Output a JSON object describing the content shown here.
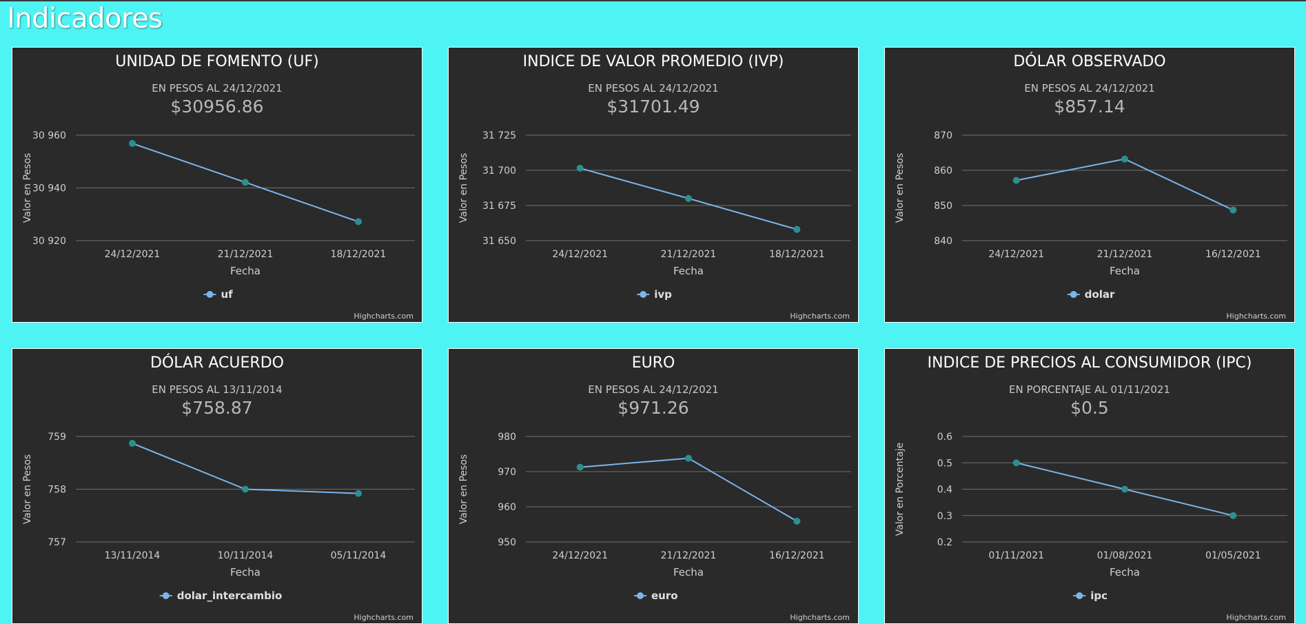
{
  "page": {
    "title": "Indicadores"
  },
  "chart_data": [
    {
      "type": "line",
      "title": "UNIDAD DE FOMENTO (UF)",
      "subtitle": "EN PESOS AL 24/12/2021",
      "value_text": "$30956.86",
      "categories": [
        "24/12/2021",
        "21/12/2021",
        "18/12/2021"
      ],
      "series": [
        {
          "name": "uf",
          "values": [
            30956.86,
            30942.1,
            30927.2
          ]
        }
      ],
      "xlabel": "Fecha",
      "ylabel": "Valor en Pesos",
      "ylim": [
        30920,
        30960
      ],
      "yticks": [
        30920,
        30940,
        30960
      ],
      "ytick_labels": [
        "30 920",
        "30 940",
        "30 960"
      ],
      "grid": true,
      "legend": "bottom-center",
      "credits": "Highcharts.com"
    },
    {
      "type": "line",
      "title": "INDICE DE VALOR PROMEDIO (IVP)",
      "subtitle": "EN PESOS AL 24/12/2021",
      "value_text": "$31701.49",
      "categories": [
        "24/12/2021",
        "21/12/2021",
        "18/12/2021"
      ],
      "series": [
        {
          "name": "ivp",
          "values": [
            31701.49,
            31680,
            31658
          ]
        }
      ],
      "xlabel": "Fecha",
      "ylabel": "Valor en Pesos",
      "ylim": [
        31650,
        31725
      ],
      "yticks": [
        31650,
        31675,
        31700,
        31725
      ],
      "ytick_labels": [
        "31 650",
        "31 675",
        "31 700",
        "31 725"
      ],
      "grid": true,
      "legend": "bottom-center",
      "credits": "Highcharts.com"
    },
    {
      "type": "line",
      "title": "DÓLAR OBSERVADO",
      "subtitle": "EN PESOS AL 24/12/2021",
      "value_text": "$857.14",
      "categories": [
        "24/12/2021",
        "21/12/2021",
        "16/12/2021"
      ],
      "series": [
        {
          "name": "dolar",
          "values": [
            857.14,
            863.2,
            848.7
          ]
        }
      ],
      "xlabel": "Fecha",
      "ylabel": "Valor en Pesos",
      "ylim": [
        840,
        870
      ],
      "yticks": [
        840,
        850,
        860,
        870
      ],
      "ytick_labels": [
        "840",
        "850",
        "860",
        "870"
      ],
      "grid": true,
      "legend": "bottom-center",
      "credits": "Highcharts.com"
    },
    {
      "type": "line",
      "title": "DÓLAR ACUERDO",
      "subtitle": "EN PESOS AL 13/11/2014",
      "value_text": "$758.87",
      "categories": [
        "13/11/2014",
        "10/11/2014",
        "05/11/2014"
      ],
      "series": [
        {
          "name": "dolar_intercambio",
          "values": [
            758.87,
            758.0,
            757.92
          ]
        }
      ],
      "xlabel": "Fecha",
      "ylabel": "Valor en Pesos",
      "ylim": [
        757,
        759
      ],
      "yticks": [
        757,
        758,
        759
      ],
      "ytick_labels": [
        "757",
        "758",
        "759"
      ],
      "grid": true,
      "legend": "bottom-center",
      "credits": "Highcharts.com"
    },
    {
      "type": "line",
      "title": "EURO",
      "subtitle": "EN PESOS AL 24/12/2021",
      "value_text": "$971.26",
      "categories": [
        "24/12/2021",
        "21/12/2021",
        "16/12/2021"
      ],
      "series": [
        {
          "name": "euro",
          "values": [
            971.26,
            973.8,
            955.9
          ]
        }
      ],
      "xlabel": "Fecha",
      "ylabel": "Valor en Pesos",
      "ylim": [
        950,
        980
      ],
      "yticks": [
        950,
        960,
        970,
        980
      ],
      "ytick_labels": [
        "950",
        "960",
        "970",
        "980"
      ],
      "grid": true,
      "legend": "bottom-center",
      "credits": "Highcharts.com"
    },
    {
      "type": "line",
      "title": "INDICE DE PRECIOS AL CONSUMIDOR (IPC)",
      "subtitle": "EN PORCENTAJE AL 01/11/2021",
      "value_text": "$0.5",
      "categories": [
        "01/11/2021",
        "01/08/2021",
        "01/05/2021"
      ],
      "series": [
        {
          "name": "ipc",
          "values": [
            0.5,
            0.4,
            0.3
          ]
        }
      ],
      "xlabel": "Fecha",
      "ylabel": "Valor en Porcentaje",
      "ylim": [
        0.2,
        0.6
      ],
      "yticks": [
        0.2,
        0.3,
        0.4,
        0.5,
        0.6
      ],
      "ytick_labels": [
        "0.2",
        "0.3",
        "0.4",
        "0.5",
        "0.6"
      ],
      "grid": true,
      "legend": "bottom-center",
      "credits": "Highcharts.com"
    }
  ],
  "colors": {
    "background": "#4ef4f4",
    "card": "#2a2a2a",
    "line": "#7cb5ec",
    "marker": "#2b908f",
    "grid": "#707070",
    "legend_text": "#e0e0e3"
  }
}
